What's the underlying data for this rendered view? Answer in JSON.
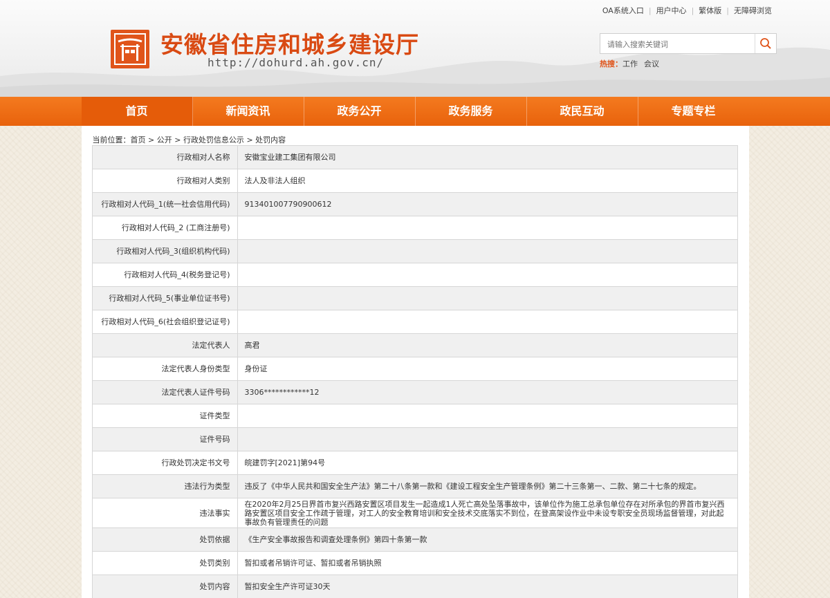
{
  "top_links": [
    "OA系统入口",
    "用户中心",
    "繁体版",
    "无障碍浏览"
  ],
  "site": {
    "title": "安徽省住房和城乡建设厅",
    "url": "http://dohurd.ah.gov.cn/"
  },
  "search": {
    "placeholder": "请输入搜索关键词",
    "hot_label": "热搜：",
    "hot_terms": [
      "工作",
      "会议"
    ]
  },
  "nav": [
    "首页",
    "新闻资讯",
    "政务公开",
    "政务服务",
    "政民互动",
    "专题专栏"
  ],
  "breadcrumb": {
    "prefix": "当前位置：",
    "items": [
      "首页",
      "公开",
      "行政处罚信息公示",
      "处罚内容"
    ],
    "sep": ">"
  },
  "rows": [
    {
      "label": "行政相对人名称",
      "value": "安徽宝业建工集团有限公司"
    },
    {
      "label": "行政相对人类别",
      "value": "法人及非法人组织"
    },
    {
      "label": "行政相对人代码_1(统一社会信用代码)",
      "value": "913401007790900612"
    },
    {
      "label": "行政相对人代码_2 (工商注册号)",
      "value": ""
    },
    {
      "label": "行政相对人代码_3(组织机构代码)",
      "value": ""
    },
    {
      "label": "行政相对人代码_4(税务登记号)",
      "value": ""
    },
    {
      "label": "行政相对人代码_5(事业单位证书号)",
      "value": ""
    },
    {
      "label": "行政相对人代码_6(社会组织登记证号)",
      "value": ""
    },
    {
      "label": "法定代表人",
      "value": "高君"
    },
    {
      "label": "法定代表人身份类型",
      "value": "身份证"
    },
    {
      "label": "法定代表人证件号码",
      "value": "3306************12"
    },
    {
      "label": "证件类型",
      "value": ""
    },
    {
      "label": "证件号码",
      "value": ""
    },
    {
      "label": "行政处罚决定书文号",
      "value": "皖建罚字[2021]第94号"
    },
    {
      "label": "违法行为类型",
      "value": "违反了《中华人民共和国安全生产法》第二十八条第一款和《建设工程安全生产管理条例》第二十三条第一、二款、第二十七条的规定。"
    },
    {
      "label": "违法事实",
      "value": "在2020年2月25日界首市复兴西路安置区项目发生一起造成1人死亡高处坠落事故中，该单位作为施工总承包单位存在对所承包的界首市复兴西路安置区项目安全工作疏于管理，对工人的安全教育培训和安全技术交底落实不到位，在登高架设作业中未设专职安全员现场监督管理，对此起事故负有管理责任的问题"
    },
    {
      "label": "处罚依据",
      "value": "《生产安全事故报告和调查处理条例》第四十条第一款"
    },
    {
      "label": "处罚类别",
      "value": "暂扣或者吊销许可证、暂扣或者吊销执照"
    },
    {
      "label": "处罚内容",
      "value": "暂扣安全生产许可证30天"
    }
  ],
  "colors": {
    "brand_orange": "#e0541a",
    "nav_orange": "#f26f14",
    "row_alt": "#f0f0f0"
  }
}
